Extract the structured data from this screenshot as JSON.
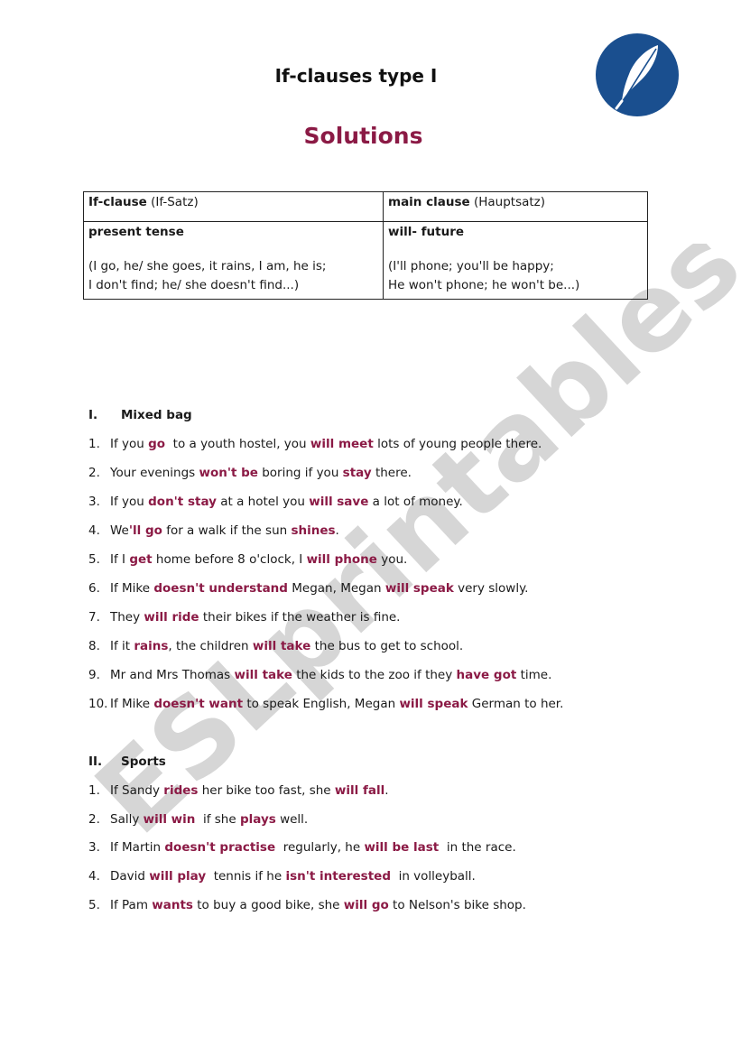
{
  "header": {
    "title": "If-clauses type I",
    "subtitle": "Solutions",
    "logo_icon": "feather-logo-icon"
  },
  "colors": {
    "accent": "#8b1a45",
    "logo_blue": "#1a4f8f",
    "watermark": "#cfcfcf"
  },
  "watermark": {
    "text": "ESLprintables.com"
  },
  "grammar_table": {
    "col1_header_bold": "If-clause",
    "col1_header_rest": " (If-Satz)",
    "col2_header_bold": "main clause",
    "col2_header_rest": " (Hauptsatz)",
    "col1_tense": "present tense",
    "col2_tense": "will- future",
    "col1_examples_line1": "(I go, he/ she goes, it rains, I am, he is;",
    "col1_examples_line2": "I don't find; he/ she doesn't find...)",
    "col2_examples_line1": "(I'll phone; you'll be happy;",
    "col2_examples_line2": "He won't phone; he won't be...)"
  },
  "sections": [
    {
      "numeral": "I.",
      "title": "Mixed bag",
      "items": [
        {
          "num": "1.",
          "parts": [
            [
              "If you ",
              0
            ],
            [
              "go",
              1
            ],
            [
              "  to a youth hostel, you ",
              0
            ],
            [
              "will meet",
              1
            ],
            [
              " lots of young people there.",
              0
            ]
          ]
        },
        {
          "num": "2.",
          "parts": [
            [
              "Your evenings ",
              0
            ],
            [
              "won't be",
              1
            ],
            [
              " boring if you ",
              0
            ],
            [
              "stay",
              1
            ],
            [
              " there.",
              0
            ]
          ]
        },
        {
          "num": "3.",
          "parts": [
            [
              "If you ",
              0
            ],
            [
              "don't stay",
              1
            ],
            [
              " at a hotel you ",
              0
            ],
            [
              "will save",
              1
            ],
            [
              " a lot of money.",
              0
            ]
          ]
        },
        {
          "num": "4.",
          "parts": [
            [
              "We",
              0
            ],
            [
              "'ll go",
              1
            ],
            [
              " for a walk if the sun ",
              0
            ],
            [
              "shines",
              1
            ],
            [
              ".",
              0
            ]
          ]
        },
        {
          "num": "5.",
          "parts": [
            [
              "If I ",
              0
            ],
            [
              "get",
              1
            ],
            [
              " home before 8 o'clock, I ",
              0
            ],
            [
              "will phone",
              1
            ],
            [
              " you.",
              0
            ]
          ]
        },
        {
          "num": "6.",
          "parts": [
            [
              "If Mike ",
              0
            ],
            [
              "doesn't understand",
              1
            ],
            [
              " Megan, Megan ",
              0
            ],
            [
              "will speak",
              1
            ],
            [
              " very slowly.",
              0
            ]
          ]
        },
        {
          "num": "7.",
          "parts": [
            [
              "They ",
              0
            ],
            [
              "will ride",
              1
            ],
            [
              " their bikes if the weather is fine.",
              0
            ]
          ]
        },
        {
          "num": "8.",
          "parts": [
            [
              "If it ",
              0
            ],
            [
              "rains",
              1
            ],
            [
              ", the children ",
              0
            ],
            [
              "will take",
              1
            ],
            [
              " the bus to get to school.",
              0
            ]
          ]
        },
        {
          "num": "9.",
          "parts": [
            [
              "Mr and Mrs Thomas ",
              0
            ],
            [
              "will take",
              1
            ],
            [
              " the kids to the zoo if they ",
              0
            ],
            [
              "have got",
              1
            ],
            [
              " time.",
              0
            ]
          ]
        },
        {
          "num": "10.",
          "parts": [
            [
              "If Mike ",
              0
            ],
            [
              "doesn't want",
              1
            ],
            [
              " to speak English, Megan ",
              0
            ],
            [
              "will speak",
              1
            ],
            [
              " German to her.",
              0
            ]
          ]
        }
      ]
    },
    {
      "numeral": "II.",
      "title": "Sports",
      "items": [
        {
          "num": "1.",
          "parts": [
            [
              "If Sandy ",
              0
            ],
            [
              "rides",
              1
            ],
            [
              " her bike too fast, she ",
              0
            ],
            [
              "will fall",
              1
            ],
            [
              ".",
              0
            ]
          ]
        },
        {
          "num": "2.",
          "parts": [
            [
              "Sally ",
              0
            ],
            [
              "will win",
              1
            ],
            [
              "  if she ",
              0
            ],
            [
              "plays",
              1
            ],
            [
              " well.",
              0
            ]
          ]
        },
        {
          "num": "3.",
          "parts": [
            [
              "If Martin ",
              0
            ],
            [
              "doesn't practise",
              1
            ],
            [
              "  regularly, he ",
              0
            ],
            [
              "will be last",
              1
            ],
            [
              "  in the race.",
              0
            ]
          ]
        },
        {
          "num": "4.",
          "parts": [
            [
              "David ",
              0
            ],
            [
              "will play",
              1
            ],
            [
              "  tennis if he ",
              0
            ],
            [
              "isn't interested",
              1
            ],
            [
              "  in volleyball.",
              0
            ]
          ]
        },
        {
          "num": "5.",
          "parts": [
            [
              "If Pam ",
              0
            ],
            [
              "wants",
              1
            ],
            [
              " to buy a good bike, she ",
              0
            ],
            [
              "will go",
              1
            ],
            [
              " to Nelson's bike shop.",
              0
            ]
          ]
        }
      ]
    }
  ]
}
